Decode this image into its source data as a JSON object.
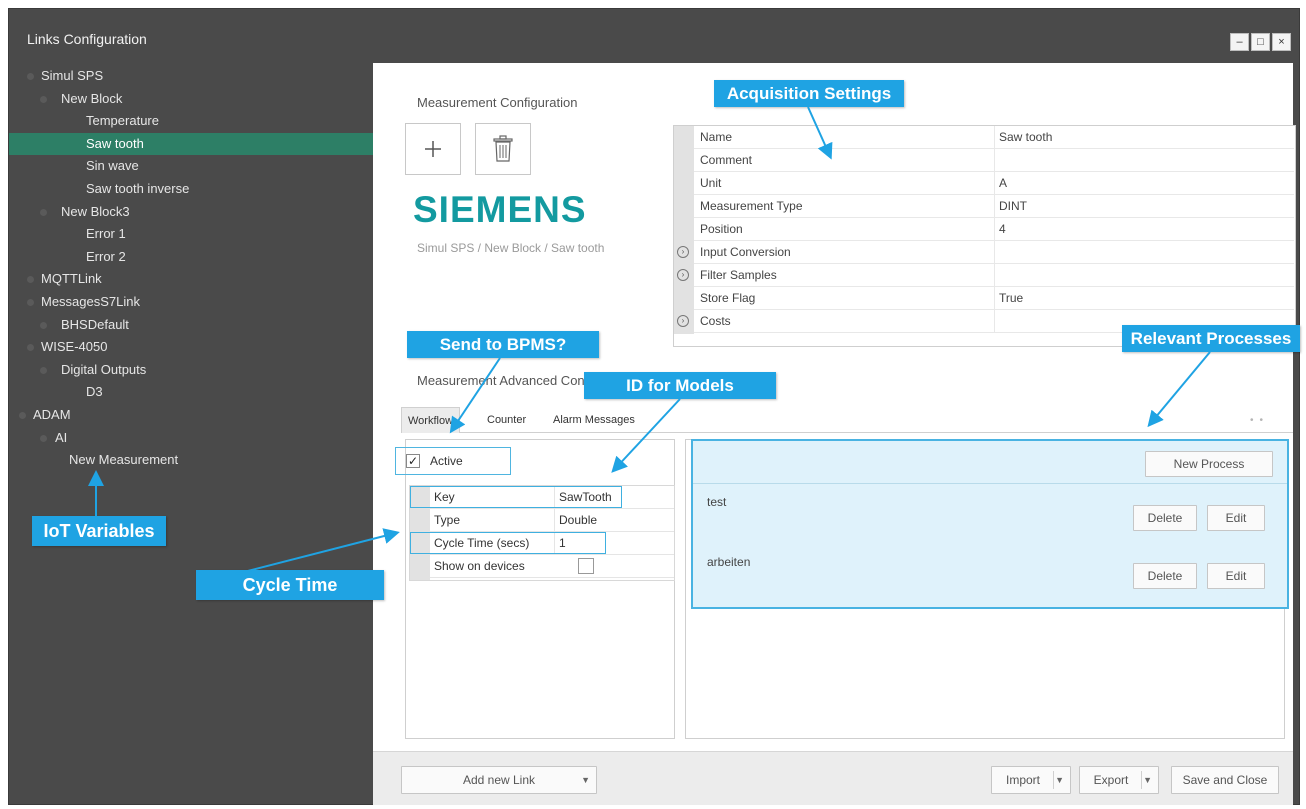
{
  "window": {
    "title": "Links Configuration",
    "controls": {
      "minimize": "–",
      "maximize": "□",
      "close": "×"
    }
  },
  "tree": {
    "items": [
      {
        "label": "Simul SPS",
        "level": 0
      },
      {
        "label": "New Block",
        "level": 1
      },
      {
        "label": "Temperature",
        "level": 2
      },
      {
        "label": "Saw tooth",
        "level": 2,
        "selected": true
      },
      {
        "label": "Sin wave",
        "level": 2
      },
      {
        "label": "Saw tooth inverse",
        "level": 2
      },
      {
        "label": "New Block3",
        "level": 1
      },
      {
        "label": "Error 1",
        "level": 2
      },
      {
        "label": "Error 2",
        "level": 2
      },
      {
        "label": "MQTTLink",
        "level": 0
      },
      {
        "label": "MessagesS7Link",
        "level": 0
      },
      {
        "label": "BHSDefault",
        "level": 1
      },
      {
        "label": "WISE-4050",
        "level": 0
      },
      {
        "label": "Digital Outputs",
        "level": 1
      },
      {
        "label": "D3",
        "level": 2
      },
      {
        "label": "ADAM",
        "level": 0
      },
      {
        "label": "AI",
        "level": 1
      },
      {
        "label": "New Measurement",
        "level": 2
      }
    ]
  },
  "measurement": {
    "title": "Measurement Configuration",
    "add_icon": "plus-icon",
    "delete_icon": "trash-icon",
    "logo": "SIEMENS",
    "breadcrumb": "Simul SPS / New Block / Saw tooth",
    "properties": [
      {
        "name": "Name",
        "value": "Saw tooth"
      },
      {
        "name": "Comment",
        "value": ""
      },
      {
        "name": "Unit",
        "value": "A"
      },
      {
        "name": "Measurement Type",
        "value": "DINT"
      },
      {
        "name": "Position",
        "value": "4"
      },
      {
        "name": "Input Conversion",
        "value": "",
        "expandable": true
      },
      {
        "name": "Filter Samples",
        "value": "",
        "expandable": true
      },
      {
        "name": "Store Flag",
        "value": "True"
      },
      {
        "name": "Costs",
        "value": "",
        "expandable": true
      }
    ]
  },
  "advanced": {
    "title": "Measurement Advanced Configuration",
    "tabs": [
      "Workflow",
      "Counter",
      "Alarm Messages"
    ],
    "active_label": "Active",
    "active_checked": true,
    "workflow_props": [
      {
        "name": "Key",
        "value": "SawTooth"
      },
      {
        "name": "Type",
        "value": "Double"
      },
      {
        "name": "Cycle Time (secs)",
        "value": "1"
      },
      {
        "name": "Show on devices",
        "value": ""
      }
    ]
  },
  "processes": {
    "new_button": "New Process",
    "items": [
      {
        "name": "test",
        "delete": "Delete",
        "edit": "Edit"
      },
      {
        "name": "arbeiten",
        "delete": "Delete",
        "edit": "Edit"
      }
    ]
  },
  "footer": {
    "add_link": "Add new Link",
    "import": "Import",
    "export": "Export",
    "save": "Save and Close"
  },
  "callouts": {
    "acquisition": "Acquisition Settings",
    "send_bpms": "Send to BPMS?",
    "id_models": "ID for Models",
    "relevant": "Relevant Processes",
    "iot": "IoT Variables",
    "cycle": "Cycle Time"
  },
  "colors": {
    "sidebar": "#4a4a4a",
    "selected": "#2d7f66",
    "brand": "#139aa0",
    "callout": "#1fa3e3",
    "highlight": "#dff2fb"
  }
}
